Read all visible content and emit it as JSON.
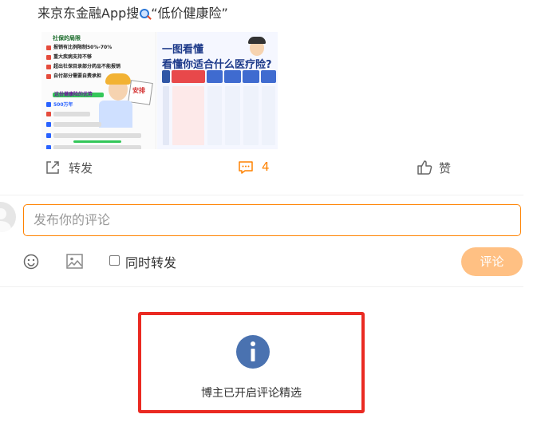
{
  "post": {
    "text_before": "来京东金融App搜",
    "text_after": "“低价健康险”",
    "search_icon": "magnifier-icon"
  },
  "images": [
    {
      "name": "notes-image",
      "title": "社保的局限",
      "lines": [
        "报销有比例限制50%-70%",
        "重大疾病支持不够",
        "超出社保目录部分药品不能报销",
        "自付部分需要自费承担"
      ],
      "banner": "这份健康险的优势",
      "highlight_number": "500万年",
      "sticker": "安排"
    },
    {
      "name": "insurance-compare-image",
      "heading1": "一图看懂",
      "heading2": "看懂你适合什么医疗险?"
    }
  ],
  "actions": {
    "share_label": "转发",
    "comment_count": "4",
    "like_label": "赞"
  },
  "composer": {
    "placeholder": "发布你的评论",
    "repost_label": "同时转发",
    "submit_label": "评论"
  },
  "notice": {
    "text": "博主已开启评论精选",
    "icon": "info-icon",
    "frame_color": "#ea2a22"
  },
  "colors": {
    "accent": "#ff8200",
    "submit_disabled": "#ffc083",
    "info": "#4a72b0"
  }
}
